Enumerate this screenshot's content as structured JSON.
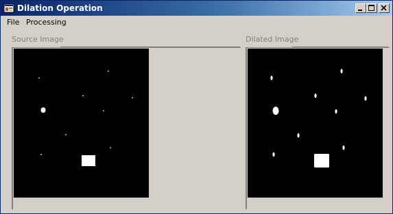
{
  "window": {
    "title": "Dilation Operation",
    "icon": "app-window-icon",
    "controls": {
      "minimize_icon": "minimize-icon",
      "maximize_icon": "maximize-icon",
      "close_icon": "close-icon"
    }
  },
  "menu": {
    "items": [
      {
        "label": "File"
      },
      {
        "label": "Processing"
      }
    ]
  },
  "source": {
    "label": "Source Image"
  },
  "dilated": {
    "label": "Dilated Image"
  },
  "colors": {
    "title_gradient_start": "#0a246a",
    "title_gradient_end": "#a6caf0",
    "image_background": "#000000",
    "image_foreground": "#ffffff",
    "window_face": "#d4d0c8"
  }
}
